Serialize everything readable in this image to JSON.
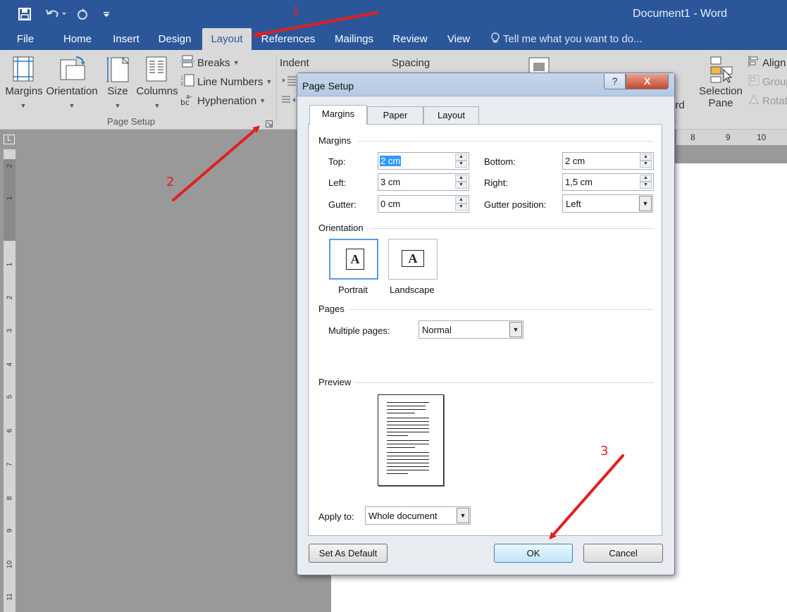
{
  "window": {
    "title": "Document1 - Word"
  },
  "quick_access": {
    "save_icon": "save-icon",
    "undo_icon": "undo-icon",
    "redo_icon": "redo-icon",
    "customize_icon": "customize-icon"
  },
  "tabs": [
    {
      "label": "File"
    },
    {
      "label": "Home"
    },
    {
      "label": "Insert"
    },
    {
      "label": "Design"
    },
    {
      "label": "Layout"
    },
    {
      "label": "References"
    },
    {
      "label": "Mailings"
    },
    {
      "label": "Review"
    },
    {
      "label": "View"
    }
  ],
  "active_tab": "Layout",
  "tell_me": "Tell me what you want to do...",
  "ribbon": {
    "margins": "Margins",
    "orientation": "Orientation",
    "size": "Size",
    "columns": "Columns",
    "breaks": "Breaks",
    "line_numbers": "Line Numbers",
    "hyphenation": "Hyphenation",
    "page_setup_group": "Page Setup",
    "indent": "Indent",
    "spacing": "Spacing",
    "selection_pane_1": "Selection",
    "selection_pane_2": "Pane",
    "align": "Align",
    "group": "Group",
    "rotate": "Rotat",
    "partial_1": "d",
    "partial_2": "ard",
    "partial_3": "e"
  },
  "ruler": {
    "vertical_numbers": [
      "2",
      "1",
      "1",
      "2",
      "3",
      "4",
      "5",
      "6",
      "7",
      "8",
      "9",
      "10",
      "11"
    ],
    "horizontal_numbers": [
      "8",
      "9",
      "10"
    ],
    "corner": "L"
  },
  "dialog": {
    "title": "Page Setup",
    "help": "?",
    "close": "X",
    "tabs": [
      "Margins",
      "Paper",
      "Layout"
    ],
    "active_tab": "Margins",
    "margins_section": "Margins",
    "top_label": "Top:",
    "top_value": "2 cm",
    "bottom_label": "Bottom:",
    "bottom_value": "2 cm",
    "left_label": "Left:",
    "left_value": "3 cm",
    "right_label": "Right:",
    "right_value": "1,5 cm",
    "gutter_label": "Gutter:",
    "gutter_value": "0 cm",
    "gutter_position_label": "Gutter position:",
    "gutter_position_value": "Left",
    "orientation_section": "Orientation",
    "portrait": "Portrait",
    "landscape": "Landscape",
    "selected_orientation": "Portrait",
    "pages_section": "Pages",
    "multiple_pages_label": "Multiple pages:",
    "multiple_pages_value": "Normal",
    "preview_section": "Preview",
    "apply_to_label": "Apply to:",
    "apply_to_value": "Whole document",
    "set_default": "Set As Default",
    "ok": "OK",
    "cancel": "Cancel"
  },
  "annotations": [
    "1",
    "2",
    "3"
  ],
  "colors": {
    "word_blue": "#2b579a",
    "annotation_red": "#e02020",
    "ribbon_gray": "#d9d9d9"
  }
}
